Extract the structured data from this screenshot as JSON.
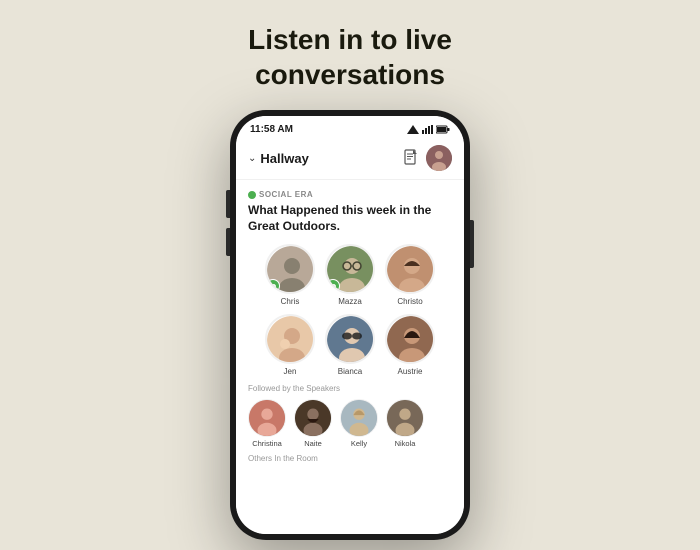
{
  "page": {
    "background": "#e8e4d8",
    "headline_line1": "Listen in to live",
    "headline_line2": "conversations"
  },
  "status_bar": {
    "time": "11:58 AM",
    "signal": "▼◀",
    "wifi": "▲",
    "battery": "▮"
  },
  "nav": {
    "chevron": "∨",
    "title": "Hallway",
    "doc_icon": "📄",
    "avatar_initials": "A"
  },
  "room": {
    "label": "SOCIAL ERA",
    "title": "What Happened this week in the Great Outdoors."
  },
  "speakers": [
    {
      "name": "Chris",
      "avatar_class": "avatar-chris",
      "has_badge": true
    },
    {
      "name": "Mazza",
      "avatar_class": "avatar-mazza",
      "has_badge": true
    },
    {
      "name": "Christo",
      "avatar_class": "avatar-christo",
      "has_badge": false
    }
  ],
  "speakers_row2": [
    {
      "name": "Jen",
      "avatar_class": "avatar-jen",
      "has_badge": false
    },
    {
      "name": "Bianca",
      "avatar_class": "avatar-bianca",
      "has_badge": false
    },
    {
      "name": "Austrie",
      "avatar_class": "avatar-austrie",
      "has_badge": false
    }
  ],
  "followed_label": "Followed by the Speakers",
  "followers": [
    {
      "name": "Christina",
      "avatar_class": "avatar-christina"
    },
    {
      "name": "Naite",
      "avatar_class": "avatar-naite"
    },
    {
      "name": "Kelly",
      "avatar_class": "avatar-kelly"
    },
    {
      "name": "Nikola",
      "avatar_class": "avatar-nikola"
    }
  ],
  "others_label": "Others In the Room"
}
